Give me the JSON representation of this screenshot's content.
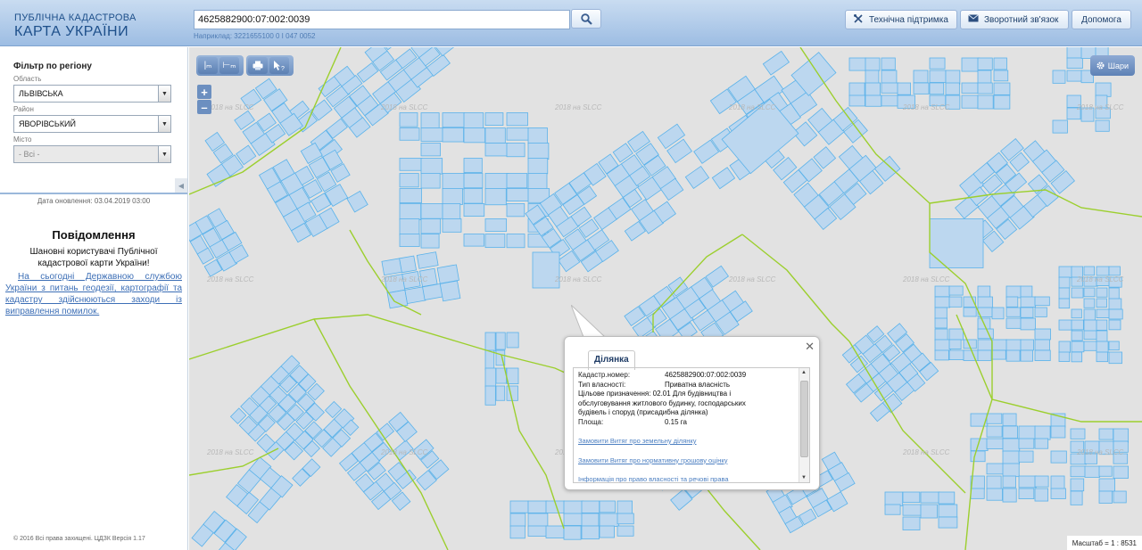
{
  "header": {
    "logo_line1": "ПУБЛІЧНА КАДАСТРОВА",
    "logo_line2": "КАРТА УКРАЇНИ",
    "search_value": "4625882900:07:002:0039",
    "example_text": "Наприклад: 3221655100 0 I 047 0052",
    "buttons": {
      "support": "Технічна підтримка",
      "feedback": "Зворотний зв'язок",
      "help": "Допомога"
    }
  },
  "sidebar": {
    "filter_title": "Фільтр по регіону",
    "region_label": "Область",
    "region_value": "ЛЬВІВСЬКА",
    "district_label": "Район",
    "district_value": "ЯВОРІВСЬКИЙ",
    "city_label": "Місто",
    "city_value": "- Всі -",
    "update_date": "Дата оновлення: 03.04.2019 03:00",
    "notice_title": "Повідомлення",
    "notice_text": "Шановні користувачі Публічної кадастрової карти України!",
    "notice_link": "На сьогодні Державною службою України з питань геодезії, картографії та кадастру здійснюються заходи із виправлення помилок.",
    "copyright": "© 2016 Всі права захищені. ЦДЗК Версія 1.17"
  },
  "map": {
    "watermark": "2018 на SLCC",
    "layers_label": "Шари",
    "zoom_in": "+",
    "zoom_out": "–",
    "scale": "Масштаб = 1 : 8531",
    "colors": {
      "background": "#e2e2e2",
      "parcel_fill": "#bcd7ef",
      "parcel_stroke": "#5ab2ea",
      "boundary": "#9ccf2e"
    }
  },
  "popup": {
    "tab": "Ділянка",
    "cadastral_label": "Кадастр.номер:",
    "cadastral_value": "4625882900:07:002:0039",
    "ownership_label": "Тип власності:",
    "ownership_value": "Приватна власність",
    "purpose_label": "Цільове призначення:",
    "purpose_value": "02.01 Для будівництва і обслуговування житлового будинку, господарських будівель і споруд (присадибна ділянка)",
    "area_label": "Площа:",
    "area_value": "0.15 га",
    "links": [
      "Замовити Витяг про земельну ділянку",
      "Замовити Витяг про нормативну грошову оцінку",
      "Інформація про право власності та речові права"
    ]
  }
}
